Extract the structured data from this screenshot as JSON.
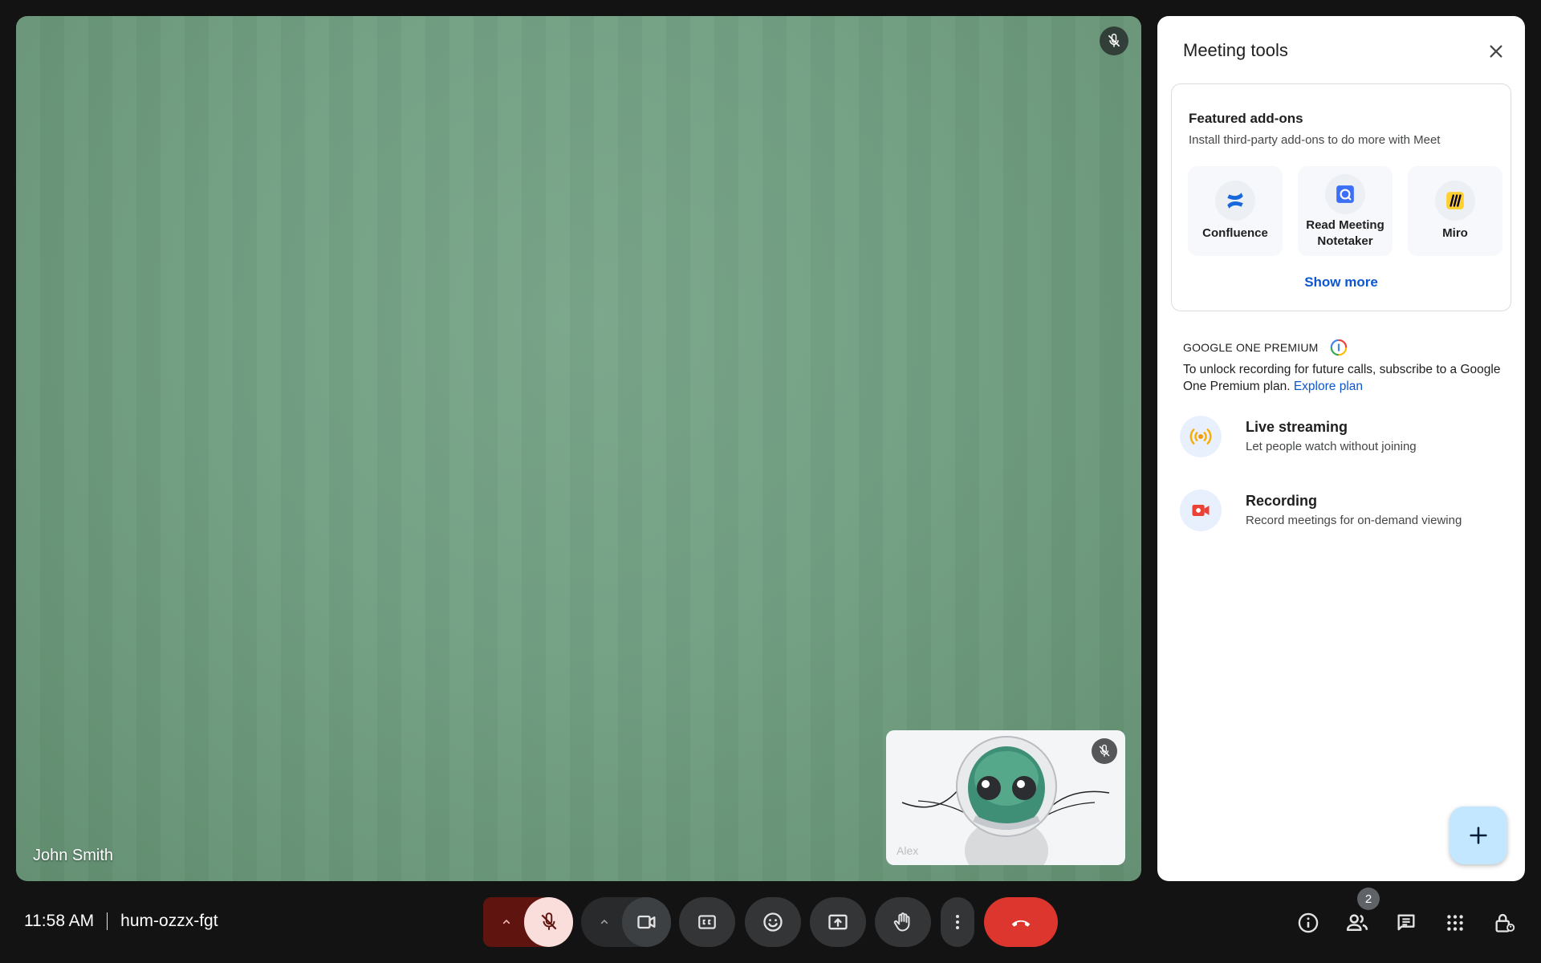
{
  "main_video": {
    "participant_name": "John Smith"
  },
  "self_view": {
    "participant_name": "Alex"
  },
  "panel": {
    "title": "Meeting tools",
    "addons": {
      "title": "Featured add-ons",
      "subtitle": "Install third-party add-ons to do more with Meet",
      "items": [
        {
          "label": "Confluence",
          "icon": "confluence-icon"
        },
        {
          "label": "Read Meeting Notetaker",
          "icon": "read-notetaker-icon"
        },
        {
          "label": "Miro",
          "icon": "miro-icon"
        }
      ],
      "show_more": "Show more"
    },
    "google_one": {
      "title": "GOOGLE ONE PREMIUM",
      "description": "To unlock recording for future calls, subscribe to a Google One Premium plan.",
      "link": "Explore plan"
    },
    "tools": [
      {
        "title": "Live streaming",
        "subtitle": "Let people watch without joining",
        "icon": "live-streaming-icon"
      },
      {
        "title": "Recording",
        "subtitle": "Record meetings for on-demand viewing",
        "icon": "recording-icon"
      }
    ]
  },
  "bottom_bar": {
    "time": "11:58 AM",
    "meeting_code": "hum-ozzx-fgt",
    "participants_count": "2"
  },
  "colors": {
    "background": "#131314",
    "end_call": "#dc362e",
    "mic_muted_bg": "#f9dedc",
    "mic_options_bg": "#601410",
    "link": "#0b57d0",
    "fab": "#c2e7ff"
  }
}
